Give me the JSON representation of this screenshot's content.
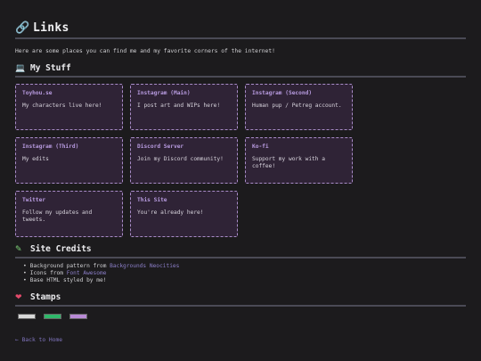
{
  "page": {
    "title": "Links",
    "title_icon": "link-icon",
    "intro": "Here are some places you can find me and my favorite corners of the internet!"
  },
  "my_stuff": {
    "heading": "My Stuff",
    "icon": "laptop-icon",
    "cards": [
      {
        "title": "Toyhou.se",
        "desc": "My characters live here!"
      },
      {
        "title": "Instagram (Main)",
        "desc": "I post art and WIPs here!"
      },
      {
        "title": "Instagram (Second)",
        "desc": "Human pup / Petreg account."
      },
      {
        "title": "Instagram (Third)",
        "desc": "My edits"
      },
      {
        "title": "Discord Server",
        "desc": "Join my Discord community!"
      },
      {
        "title": "Ko-fi",
        "desc": "Support my work with a coffee!"
      },
      {
        "title": "Twitter",
        "desc": "Follow my updates and tweets."
      },
      {
        "title": "This Site",
        "desc": "You're already here!"
      }
    ]
  },
  "credits": {
    "heading": "Site Credits",
    "icon": "paintbrush-icon",
    "items": [
      {
        "prefix": "Background pattern from ",
        "link": "Backgrounds Neocities"
      },
      {
        "prefix": "Icons from ",
        "link": "Font Awesome"
      },
      {
        "prefix": "Base HTML styled by me!",
        "link": ""
      }
    ]
  },
  "stamps": {
    "heading": "Stamps",
    "icon": "heart-icon",
    "colors": [
      "#d8d8d8",
      "#2fb86a",
      "#b98ad6"
    ]
  },
  "footer": {
    "back_link": "← Back to Home"
  },
  "colors": {
    "background": "#1c1b1d",
    "card_bg": "#2f2336",
    "card_border": "#a98cc8",
    "card_title": "#b89be0",
    "link": "#8c7fc9"
  }
}
